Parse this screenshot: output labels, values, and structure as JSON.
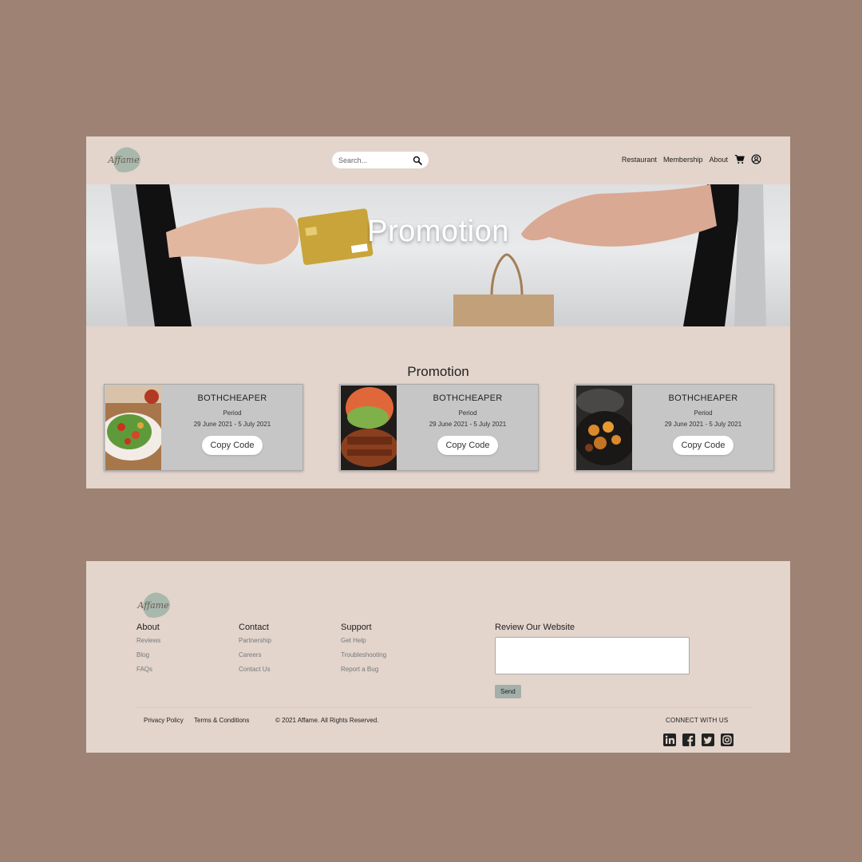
{
  "nav": {
    "logo_text": "Affame",
    "search_placeholder": "Search...",
    "links": [
      "Restaurant",
      "Membership",
      "About"
    ]
  },
  "hero": {
    "title": "Promotion"
  },
  "promotions": {
    "heading": "Promotion",
    "cards": [
      {
        "code": "BOTHCHEAPER",
        "period_label": "Period",
        "dates": "29 June 2021 - 5 July 2021",
        "button": "Copy Code"
      },
      {
        "code": "BOTHCHEAPER",
        "period_label": "Period",
        "dates": "29 June 2021 - 5 July 2021",
        "button": "Copy Code"
      },
      {
        "code": "BOTHCHEAPER",
        "period_label": "Period",
        "dates": "29 June 2021 - 5 July 2021",
        "button": "Copy Code"
      }
    ]
  },
  "footer": {
    "logo_text": "Affame",
    "columns": [
      {
        "title": "About",
        "links": [
          "Reviews",
          "Blog",
          "FAQs"
        ]
      },
      {
        "title": "Contact",
        "links": [
          "Partnership",
          "Careers",
          "Contact Us"
        ]
      },
      {
        "title": "Support",
        "links": [
          "Get Help",
          "Troubleshooting",
          "Report a Bug"
        ]
      }
    ],
    "review_title": "Review Our Website",
    "send_label": "Send",
    "privacy": "Privacy Policy",
    "terms": "Terms & Conditions",
    "copyright": "© 2021 Affame. All Rights Reserved.",
    "connect": "CONNECT WITH US",
    "social_icons": [
      "linkedin-icon",
      "facebook-icon",
      "twitter-icon",
      "instagram-icon"
    ]
  },
  "colors": {
    "background": "#9e8273",
    "panel": "#e3d5cc",
    "card": "#c6c6c6",
    "send_button": "#a3b0a9"
  }
}
